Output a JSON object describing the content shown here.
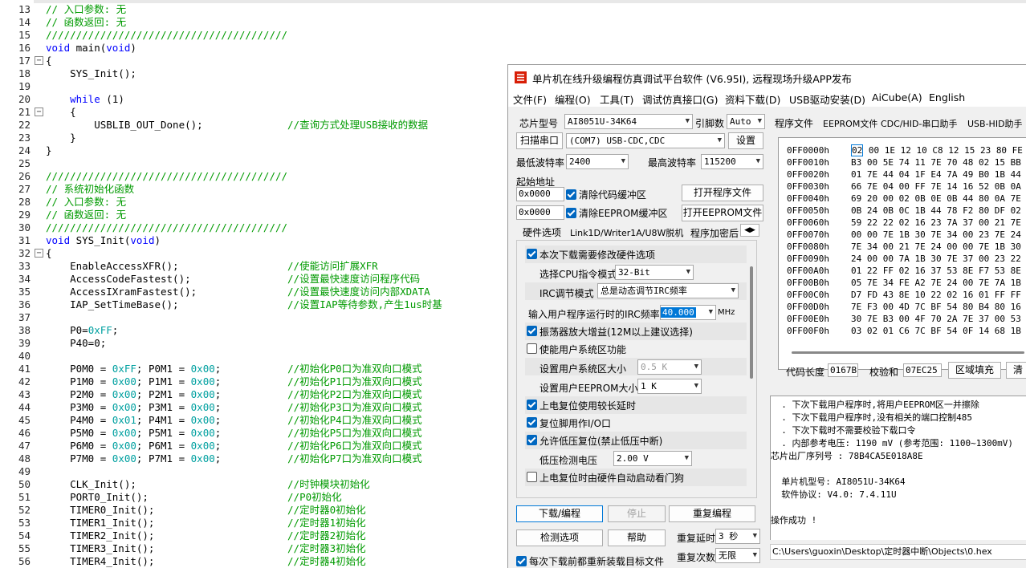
{
  "editor": {
    "lines": [
      {
        "n": "13",
        "segs": [
          {
            "t": "// 入口参数: 无",
            "c": "cm"
          }
        ]
      },
      {
        "n": "14",
        "segs": [
          {
            "t": "// 函数返回: 无",
            "c": "cm"
          }
        ]
      },
      {
        "n": "15",
        "segs": [
          {
            "t": "////////////////////////////////////////",
            "c": "cm"
          }
        ]
      },
      {
        "n": "16",
        "segs": [
          {
            "t": "void",
            "c": "kw"
          },
          {
            "t": " main("
          },
          {
            "t": "void",
            "c": "kw"
          },
          {
            "t": ")"
          }
        ]
      },
      {
        "n": "17",
        "fold": true,
        "segs": [
          {
            "t": "{"
          }
        ]
      },
      {
        "n": "18",
        "segs": [
          {
            "t": "    SYS_Init();"
          }
        ]
      },
      {
        "n": "19",
        "segs": []
      },
      {
        "n": "20",
        "segs": [
          {
            "t": "    "
          },
          {
            "t": "while",
            "c": "kw"
          },
          {
            "t": " (1)"
          }
        ]
      },
      {
        "n": "21",
        "fold": true,
        "segs": [
          {
            "t": "    {"
          }
        ]
      },
      {
        "n": "22",
        "segs": [
          {
            "t": "        USBLIB_OUT_Done();              "
          },
          {
            "t": "//查询方式处理USB接收的数据",
            "c": "cm"
          }
        ]
      },
      {
        "n": "23",
        "segs": [
          {
            "t": "    }"
          }
        ]
      },
      {
        "n": "24",
        "segs": [
          {
            "t": "}"
          }
        ]
      },
      {
        "n": "25",
        "segs": []
      },
      {
        "n": "26",
        "segs": [
          {
            "t": "////////////////////////////////////////",
            "c": "cm"
          }
        ]
      },
      {
        "n": "27",
        "segs": [
          {
            "t": "// 系统初始化函数",
            "c": "cm"
          }
        ]
      },
      {
        "n": "28",
        "segs": [
          {
            "t": "// 入口参数: 无",
            "c": "cm"
          }
        ]
      },
      {
        "n": "29",
        "segs": [
          {
            "t": "// 函数返回: 无",
            "c": "cm"
          }
        ]
      },
      {
        "n": "30",
        "segs": [
          {
            "t": "////////////////////////////////////////",
            "c": "cm"
          }
        ]
      },
      {
        "n": "31",
        "segs": [
          {
            "t": "void",
            "c": "kw"
          },
          {
            "t": " SYS_Init("
          },
          {
            "t": "void",
            "c": "kw"
          },
          {
            "t": ")"
          }
        ]
      },
      {
        "n": "32",
        "fold": true,
        "segs": [
          {
            "t": "{"
          }
        ]
      },
      {
        "n": "33",
        "segs": [
          {
            "t": "    EnableAccessXFR();                  "
          },
          {
            "t": "//使能访问扩展XFR",
            "c": "cm"
          }
        ]
      },
      {
        "n": "34",
        "segs": [
          {
            "t": "    AccessCodeFastest();                "
          },
          {
            "t": "//设置最快速度访问程序代码",
            "c": "cm"
          }
        ]
      },
      {
        "n": "35",
        "segs": [
          {
            "t": "    AccessIXramFastest();               "
          },
          {
            "t": "//设置最快速度访问内部XDATA",
            "c": "cm"
          }
        ]
      },
      {
        "n": "36",
        "segs": [
          {
            "t": "    IAP_SetTimeBase();                  "
          },
          {
            "t": "//设置IAP等待参数,产生1us时基",
            "c": "cm"
          }
        ]
      },
      {
        "n": "37",
        "segs": []
      },
      {
        "n": "38",
        "segs": [
          {
            "t": "    P0="
          },
          {
            "t": "0xFF",
            "c": "num"
          },
          {
            "t": ";"
          }
        ]
      },
      {
        "n": "39",
        "segs": [
          {
            "t": "    P40=0;"
          }
        ]
      },
      {
        "n": "40",
        "segs": []
      },
      {
        "n": "41",
        "segs": [
          {
            "t": "    P0M0 = "
          },
          {
            "t": "0xFF",
            "c": "num"
          },
          {
            "t": "; P0M1 = "
          },
          {
            "t": "0x00",
            "c": "num"
          },
          {
            "t": ";           "
          },
          {
            "t": "//初始化P0口为准双向口模式",
            "c": "cm"
          }
        ]
      },
      {
        "n": "42",
        "segs": [
          {
            "t": "    P1M0 = "
          },
          {
            "t": "0x00",
            "c": "num"
          },
          {
            "t": "; P1M1 = "
          },
          {
            "t": "0x00",
            "c": "num"
          },
          {
            "t": ";           "
          },
          {
            "t": "//初始化P1口为准双向口模式",
            "c": "cm"
          }
        ]
      },
      {
        "n": "43",
        "segs": [
          {
            "t": "    P2M0 = "
          },
          {
            "t": "0x00",
            "c": "num"
          },
          {
            "t": "; P2M1 = "
          },
          {
            "t": "0x00",
            "c": "num"
          },
          {
            "t": ";           "
          },
          {
            "t": "//初始化P2口为准双向口模式",
            "c": "cm"
          }
        ]
      },
      {
        "n": "44",
        "segs": [
          {
            "t": "    P3M0 = "
          },
          {
            "t": "0x00",
            "c": "num"
          },
          {
            "t": "; P3M1 = "
          },
          {
            "t": "0x00",
            "c": "num"
          },
          {
            "t": ";           "
          },
          {
            "t": "//初始化P3口为准双向口模式",
            "c": "cm"
          }
        ]
      },
      {
        "n": "45",
        "segs": [
          {
            "t": "    P4M0 = "
          },
          {
            "t": "0x01",
            "c": "num"
          },
          {
            "t": "; P4M1 = "
          },
          {
            "t": "0x00",
            "c": "num"
          },
          {
            "t": ";           "
          },
          {
            "t": "//初始化P4口为准双向口模式",
            "c": "cm"
          }
        ]
      },
      {
        "n": "46",
        "segs": [
          {
            "t": "    P5M0 = "
          },
          {
            "t": "0x00",
            "c": "num"
          },
          {
            "t": "; P5M1 = "
          },
          {
            "t": "0x00",
            "c": "num"
          },
          {
            "t": ";           "
          },
          {
            "t": "//初始化P5口为准双向口模式",
            "c": "cm"
          }
        ]
      },
      {
        "n": "47",
        "segs": [
          {
            "t": "    P6M0 = "
          },
          {
            "t": "0x00",
            "c": "num"
          },
          {
            "t": "; P6M1 = "
          },
          {
            "t": "0x00",
            "c": "num"
          },
          {
            "t": ";           "
          },
          {
            "t": "//初始化P6口为准双向口模式",
            "c": "cm"
          }
        ]
      },
      {
        "n": "48",
        "segs": [
          {
            "t": "    P7M0 = "
          },
          {
            "t": "0x00",
            "c": "num"
          },
          {
            "t": "; P7M1 = "
          },
          {
            "t": "0x00",
            "c": "num"
          },
          {
            "t": ";           "
          },
          {
            "t": "//初始化P7口为准双向口模式",
            "c": "cm"
          }
        ]
      },
      {
        "n": "49",
        "segs": []
      },
      {
        "n": "50",
        "segs": [
          {
            "t": "    CLK_Init();                         "
          },
          {
            "t": "//时钟模块初始化",
            "c": "cm"
          }
        ]
      },
      {
        "n": "51",
        "segs": [
          {
            "t": "    PORT0_Init();                       "
          },
          {
            "t": "//P0初始化",
            "c": "cm"
          }
        ]
      },
      {
        "n": "52",
        "segs": [
          {
            "t": "    TIMER0_Init();                      "
          },
          {
            "t": "//定时器0初始化",
            "c": "cm"
          }
        ]
      },
      {
        "n": "53",
        "segs": [
          {
            "t": "    TIMER1_Init();                      "
          },
          {
            "t": "//定时器1初始化",
            "c": "cm"
          }
        ]
      },
      {
        "n": "54",
        "segs": [
          {
            "t": "    TIMER2_Init();                      "
          },
          {
            "t": "//定时器2初始化",
            "c": "cm"
          }
        ]
      },
      {
        "n": "55",
        "segs": [
          {
            "t": "    TIMER3_Init();                      "
          },
          {
            "t": "//定时器3初始化",
            "c": "cm"
          }
        ]
      },
      {
        "n": "56",
        "segs": [
          {
            "t": "    TIMER4_Init();                      "
          },
          {
            "t": "//定时器4初始化",
            "c": "cm"
          }
        ]
      }
    ]
  },
  "colors": {
    "comment": "#009a00",
    "keyword": "#0000ff",
    "number": "#00a0a0",
    "accent": "#0067c0"
  },
  "window": {
    "title": "单片机在线升级编程仿真调试平台软件 (V6.95I), 远程现场升级APP发布",
    "icon": "stc-app-icon",
    "menu": [
      "文件(F)",
      "编程(O)",
      "工具(T)",
      "调试仿真接口(G)",
      "资料下载(D)",
      "USB驱动安装(D)",
      "AiCube(A)",
      "English"
    ]
  },
  "left": {
    "chip_label": "芯片型号",
    "chip_value": "AI8051U-34K64",
    "pins_label": "引脚数",
    "pins_value": "Auto",
    "scan_button": "扫描串口",
    "port_value": "(COM7) USB-CDC,CDC",
    "settings_button": "设置",
    "min_baud_label": "最低波特率",
    "min_baud_value": "2400",
    "max_baud_label": "最高波特率",
    "max_baud_value": "115200",
    "start_addr_label": "起始地址",
    "addr1": "0x0000",
    "clear_code_label": "清除代码缓冲区",
    "addr2": "0x0000",
    "clear_eeprom_label": "清除EEPROM缓冲区",
    "open_program_button": "打开程序文件",
    "open_eeprom_button": "打开EEPROM文件",
    "tabs": [
      "硬件选项",
      "Link1D/Writer1A/U8W脱机",
      "程序加密后"
    ],
    "hw": {
      "modify_hw_label": "本次下载需要修改硬件选项",
      "cpu_mode_label": "选择CPU指令模式",
      "cpu_mode_value": "32-Bit",
      "irc_mode_label": "IRC调节模式",
      "irc_mode_value": "总是动态调节IRC频率",
      "irc_freq_label": "输入用户程序运行时的IRC频率",
      "irc_freq_value": "40.000",
      "irc_freq_unit": "MHz",
      "osc_gain_label": "振荡器放大增益(12M以上建议选择)",
      "user_sys_label": "使能用户系统区功能",
      "user_sys_size_label": "设置用户系统区大小",
      "user_sys_size_value": "0.5 K",
      "user_eeprom_label": "设置用户EEPROM大小",
      "user_eeprom_value": "1  K",
      "long_delay_label": "上电复位使用较长延时",
      "reset_io_label": "复位脚用作I/O口",
      "lvr_label": "允许低压复位(禁止低压中断)",
      "lvd_label": "低压检测电压",
      "lvd_value": "2.00 V",
      "watchdog_label": "上电复位时由硬件自动启动看门狗"
    },
    "download_button": "下载/编程",
    "stop_button": "停止",
    "reprogram_button": "重复编程",
    "check_button": "检测选项",
    "help_button": "帮助",
    "repeat_delay_label": "重复延时",
    "repeat_delay_value": "3 秒",
    "repeat_count_label": "重复次数",
    "repeat_count_value": "无限",
    "reload_label": "每次下载前都重新装载目标文件"
  },
  "right": {
    "tabs": [
      "程序文件",
      "EEPROM文件",
      "CDC/HID-串口助手",
      "USB-HID助手"
    ],
    "hex_rows": [
      {
        "addr": "0FF0000h",
        "bytes": "02 00 1E 12 10 C8 12 15 23 80 FE"
      },
      {
        "addr": "0FF0010h",
        "bytes": "B3 00 5E 74 11 7E 70 48 02 15 BB"
      },
      {
        "addr": "0FF0020h",
        "bytes": "01 7E 44 04 1F E4 7A 49 B0 1B 44"
      },
      {
        "addr": "0FF0030h",
        "bytes": "66 7E 04 00 FF 7E 14 16 52 0B 0A"
      },
      {
        "addr": "0FF0040h",
        "bytes": "69 20 00 02 0B 0E 0B 44 80 0A 7E"
      },
      {
        "addr": "0FF0050h",
        "bytes": "0B 24 0B 0C 1B 44 78 F2 80 DF 02"
      },
      {
        "addr": "0FF0060h",
        "bytes": "59 22 22 02 16 23 7A 37 00 21 7E"
      },
      {
        "addr": "0FF0070h",
        "bytes": "00 00 7E 1B 30 7E 34 00 23 7E 24"
      },
      {
        "addr": "0FF0080h",
        "bytes": "7E 34 00 21 7E 24 00 00 7E 1B 30"
      },
      {
        "addr": "0FF0090h",
        "bytes": "24 00 00 7A 1B 30 7E 37 00 23 22"
      },
      {
        "addr": "0FF00A0h",
        "bytes": "01 22 FF 02 16 37 53 8E F7 53 8E"
      },
      {
        "addr": "0FF00B0h",
        "bytes": "05 7E 34 FE A2 7E 24 00 7E 7A 1B"
      },
      {
        "addr": "0FF00C0h",
        "bytes": "D7 FD 43 8E 10 22 02 16 01 FF FF"
      },
      {
        "addr": "0FF00D0h",
        "bytes": "7E F3 00 4D 7C BF 54 80 B4 80 16"
      },
      {
        "addr": "0FF00E0h",
        "bytes": "30 7E B3 00 4F 70 2A 7E 37 00 53"
      },
      {
        "addr": "0FF00F0h",
        "bytes": "03 02 01 C6 7C BF 54 0F 14 68 1B"
      }
    ],
    "code_len_label": "代码长度",
    "code_len_value": "0167B",
    "checksum_label": "校验和",
    "checksum_value": "07EC25",
    "fill_button": "区域填充",
    "clear_button": "清"
  },
  "log": [
    "  . 下次下载用户程序时,将用户EEPROM区一并擦除",
    "  . 下次下载用户程序时,没有相关的端口控制485",
    "  . 下次下载时不需要校验下载口令",
    "  . 内部参考电压: 1190 mV (参考范围: 1100~1300mV)",
    "芯片出厂序列号 : 78B4CA5E018A8E",
    "",
    "  单片机型号: AI8051U-34K64",
    "  软件协议: V4.0: 7.4.11U",
    "",
    "操作成功 !"
  ],
  "path": "C:\\Users\\guoxin\\Desktop\\定时器中断\\Objects\\0.hex"
}
